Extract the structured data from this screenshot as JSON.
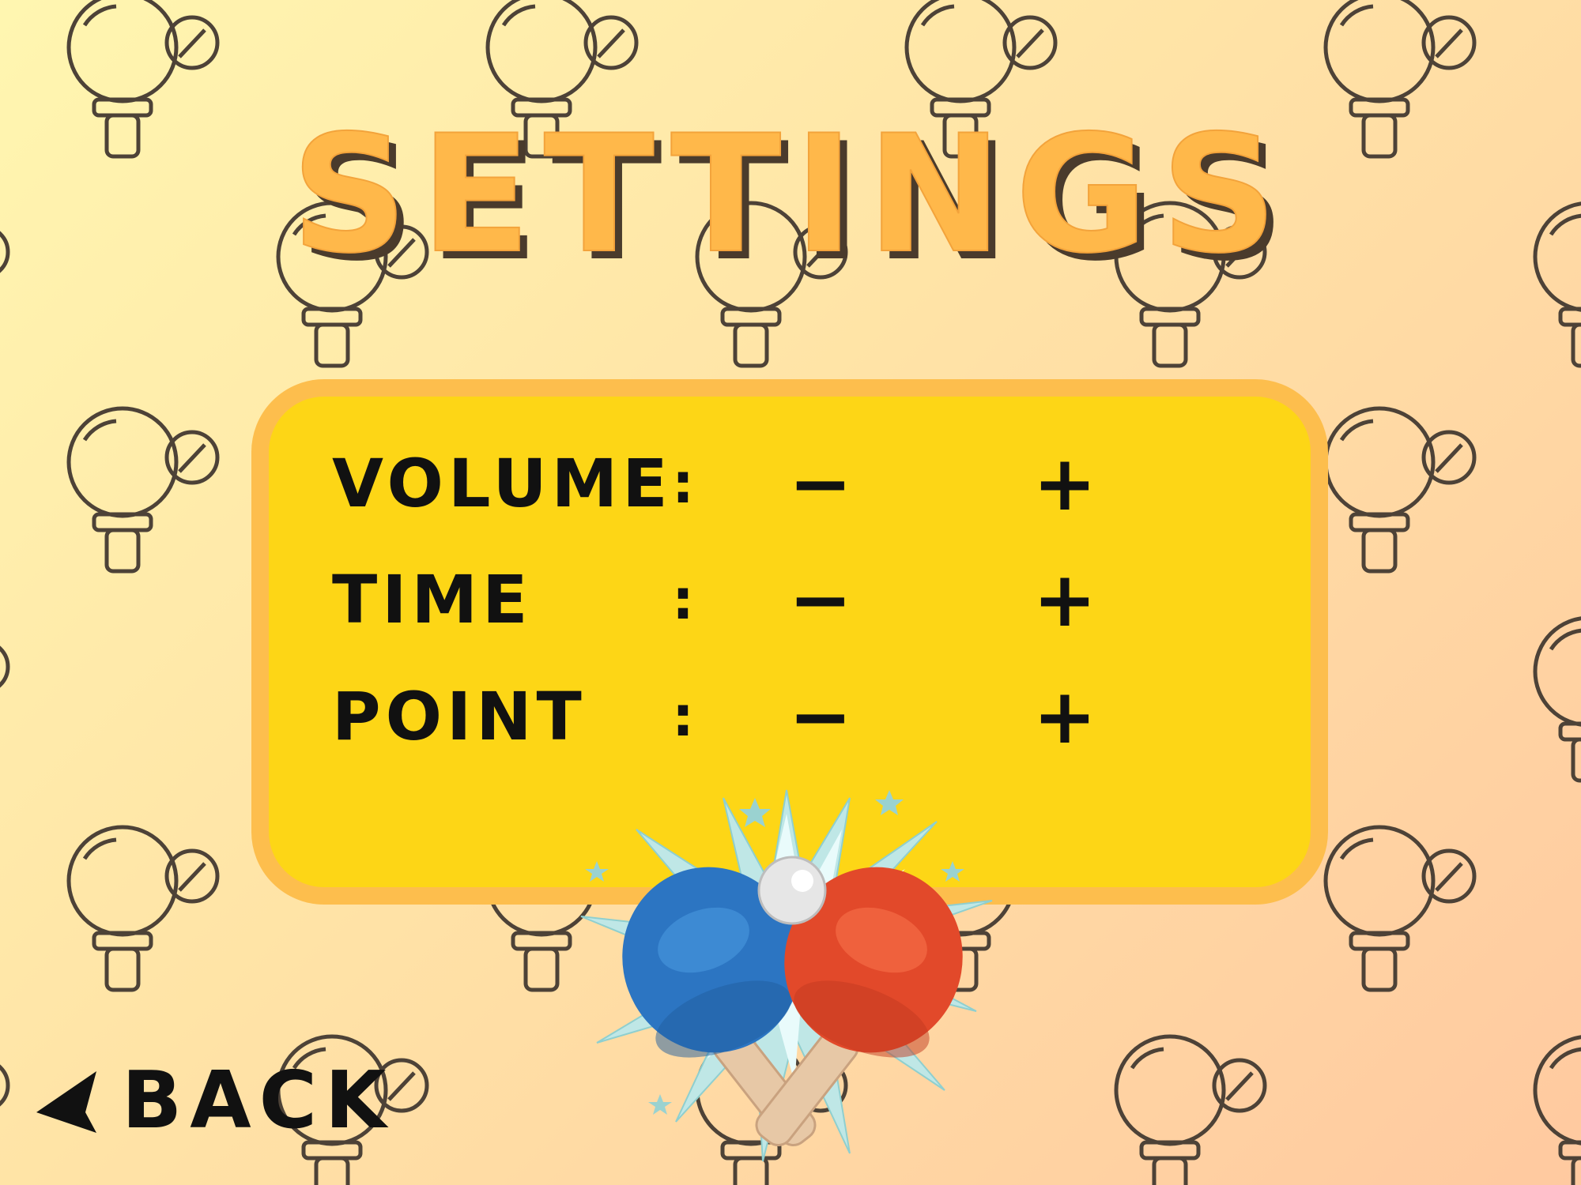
{
  "screen": {
    "title": "SETTINGS"
  },
  "settings": [
    {
      "key": "volume",
      "label": "VOLUME",
      "colon": ":",
      "decrease": "−",
      "increase": "+"
    },
    {
      "key": "time",
      "label": "TIME",
      "colon": ":",
      "decrease": "−",
      "increase": "+"
    },
    {
      "key": "point",
      "label": "POINT",
      "colon": ":",
      "decrease": "−",
      "increase": "+"
    }
  ],
  "back": {
    "label": "BACK",
    "icon": "left-triangle-icon"
  },
  "decor": {
    "background_icon": "ping-pong-paddle-ball-outline-icon",
    "emblem_icon": "crossed-ping-pong-paddles-icon"
  },
  "colors": {
    "title_fill": "#ffb84a",
    "title_shadow": "#4a3b2c",
    "panel_fill": "#fdd616",
    "panel_border": "#fdbe4d",
    "paddle_blue": "#2c75c2",
    "paddle_red": "#e2492a",
    "pattern_stroke": "#4d4237"
  }
}
